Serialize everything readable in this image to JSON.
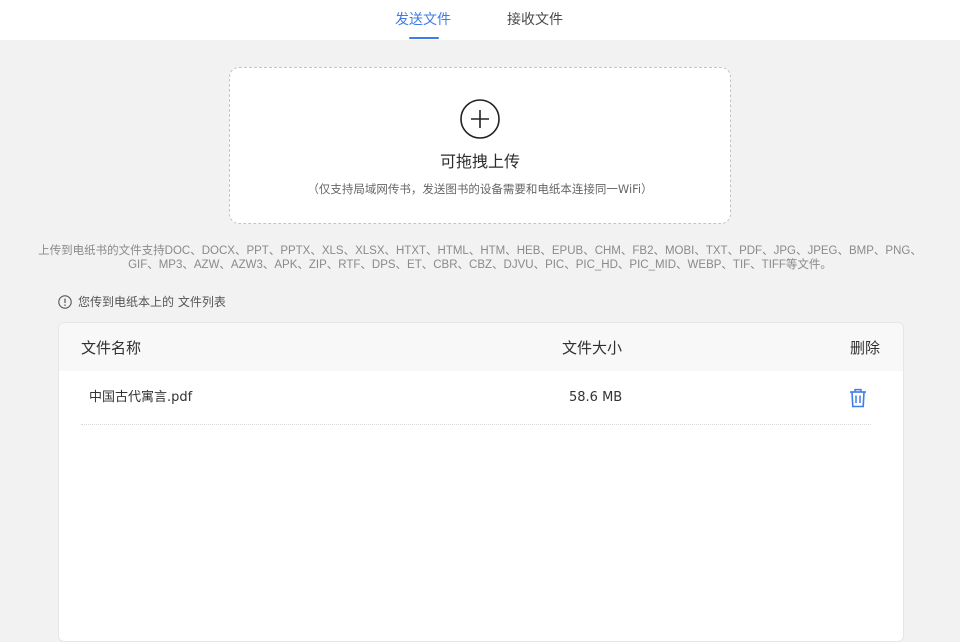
{
  "tabs": [
    {
      "label": "发送文件",
      "active": true
    },
    {
      "label": "接收文件",
      "active": false
    }
  ],
  "upload": {
    "icon": "plus-circle-icon",
    "title": "可拖拽上传",
    "hint": "（仅支持局域网传书，发送图书的设备需要和电纸本连接同一WiFi）"
  },
  "formats": {
    "line1": "上传到电纸书的文件支持DOC、DOCX、PPT、PPTX、XLS、XLSX、HTXT、HTML、HTM、HEB、EPUB、CHM、FB2、MOBI、TXT、PDF、JPG、JPEG、BMP、PNG、",
    "line2": "GIF、MP3、AZW、AZW3、APK、ZIP、RTF、DPS、ET、CBR、CBZ、DJVU、PIC、PIC_HD、PIC_MID、WEBP、TIF、TIFF等文件。"
  },
  "list": {
    "caption": "您传到电纸本上的 文件列表",
    "columns": {
      "name": "文件名称",
      "size": "文件大小",
      "delete": "删除"
    },
    "rows": [
      {
        "name": "中国古代寓言.pdf",
        "size": "58.6 MB"
      }
    ]
  },
  "colors": {
    "accent": "#3f7ce7",
    "background": "#f2f2f3"
  }
}
